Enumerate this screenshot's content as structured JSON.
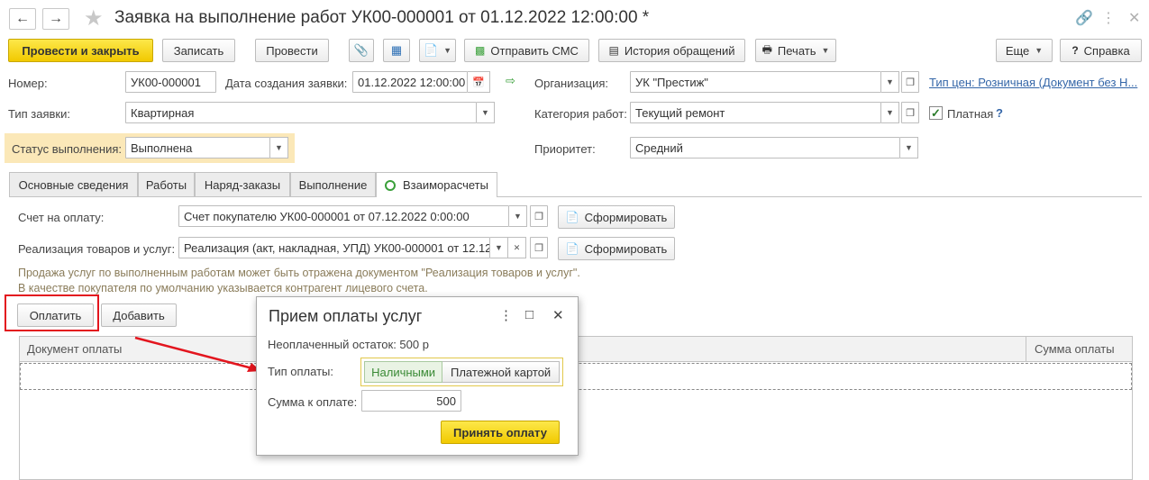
{
  "title": "Заявка на выполнение работ УК00-000001 от 01.12.2022 12:00:00 *",
  "toolbar": {
    "post_close": "Провести и закрыть",
    "write": "Записать",
    "post": "Провести",
    "sms": "Отправить СМС",
    "history": "История обращений",
    "print": "Печать",
    "more": "Еще",
    "help": "Справка"
  },
  "form": {
    "number_label": "Номер:",
    "number_value": "УК00-000001",
    "created_label": "Дата создания заявки:",
    "created_value": "01.12.2022 12:00:00",
    "org_label": "Организация:",
    "org_value": "УК \"Престиж\"",
    "price_link": "Тип цен: Розничная (Документ без Н...",
    "type_label": "Тип заявки:",
    "type_value": "Квартирная",
    "category_label": "Категория работ:",
    "category_value": "Текущий ремонт",
    "paid_label": "Платная",
    "help_q": "?",
    "status_label": "Статус выполнения:",
    "status_value": "Выполнена",
    "priority_label": "Приоритет:",
    "priority_value": "Средний"
  },
  "tabs": [
    {
      "label": "Основные сведения"
    },
    {
      "label": "Работы"
    },
    {
      "label": "Наряд-заказы"
    },
    {
      "label": "Выполнение"
    },
    {
      "label": "Взаиморасчеты"
    }
  ],
  "settlements": {
    "invoice_label": "Счет на оплату:",
    "invoice_value": "Счет покупателю УК00-000001 от 07.12.2022 0:00:00",
    "sale_label": "Реализация товаров и услуг:",
    "sale_value": "Реализация (акт, накладная, УПД) УК00-000001 от 12.12.",
    "form_button": "Сформировать",
    "note_line1": "Продажа услуг по выполненным работам может быть отражена документом \"Реализация товаров и услуг\".",
    "note_line2": "В качестве покупателя по умолчанию указывается контрагент лицевого счета.",
    "pay_button": "Оплатить",
    "add_button": "Добавить",
    "col_document": "Документ оплаты",
    "col_amount": "Сумма оплаты"
  },
  "dialog": {
    "title": "Прием оплаты услуг",
    "remaining": "Неоплаченный остаток: 500 р",
    "pay_type_label": "Тип оплаты:",
    "cash": "Наличными",
    "card": "Платежной картой",
    "amount_label": "Сумма к оплате:",
    "amount_value": "500",
    "accept_button": "Принять оплату"
  },
  "colors": {
    "accent_yellow": "#f5d10b",
    "highlight_red": "#e3151e",
    "link_blue": "#3466a8"
  }
}
